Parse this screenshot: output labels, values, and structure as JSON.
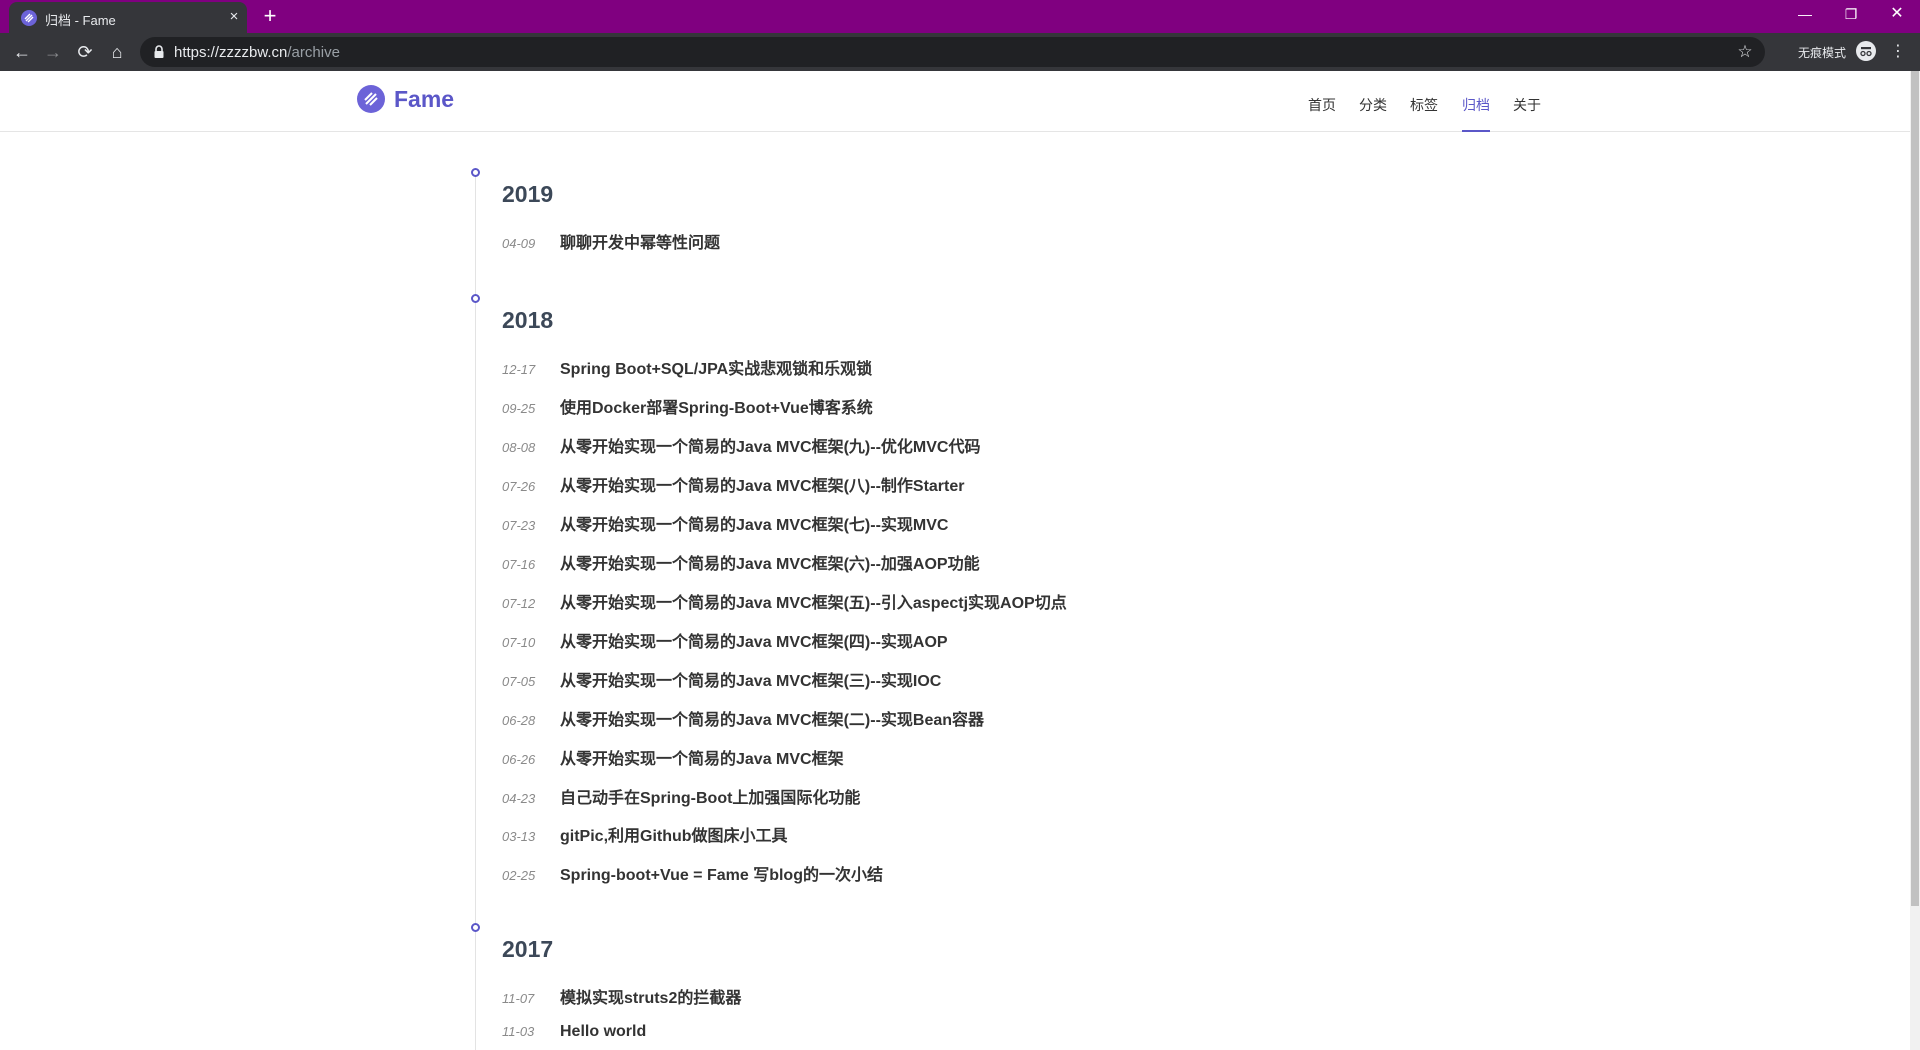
{
  "browser": {
    "tab": {
      "title": "归档 - Fame",
      "close_glyph": "×"
    },
    "new_tab_glyph": "+",
    "window_controls": {
      "minimize": "—",
      "maximize": "❐",
      "close": "✕"
    },
    "nav": {
      "back": "←",
      "forward": "→",
      "reload": "⟳",
      "home": "⌂"
    },
    "url": {
      "host": "https://zzzzbw.cn",
      "path": "/archive"
    },
    "bookmark_glyph": "☆",
    "incognito_label": "无痕模式",
    "menu_glyph": "⋮",
    "frame_color": "#800080"
  },
  "site": {
    "brand": "Fame",
    "accent_color": "#5b57c8",
    "nav": [
      {
        "label": "首页",
        "active": false
      },
      {
        "label": "分类",
        "active": false
      },
      {
        "label": "标签",
        "active": false
      },
      {
        "label": "归档",
        "active": true
      },
      {
        "label": "关于",
        "active": false
      }
    ]
  },
  "archive": [
    {
      "year": "2019",
      "posts": [
        {
          "date": "04-09",
          "title": "聊聊开发中幂等性问题"
        }
      ]
    },
    {
      "year": "2018",
      "posts": [
        {
          "date": "12-17",
          "title": "Spring Boot+SQL/JPA实战悲观锁和乐观锁"
        },
        {
          "date": "09-25",
          "title": "使用Docker部署Spring-Boot+Vue博客系统"
        },
        {
          "date": "08-08",
          "title": "从零开始实现一个简易的Java MVC框架(九)--优化MVC代码"
        },
        {
          "date": "07-26",
          "title": "从零开始实现一个简易的Java MVC框架(八)--制作Starter"
        },
        {
          "date": "07-23",
          "title": "从零开始实现一个简易的Java MVC框架(七)--实现MVC"
        },
        {
          "date": "07-16",
          "title": "从零开始实现一个简易的Java MVC框架(六)--加强AOP功能"
        },
        {
          "date": "07-12",
          "title": "从零开始实现一个简易的Java MVC框架(五)--引入aspectj实现AOP切点"
        },
        {
          "date": "07-10",
          "title": "从零开始实现一个简易的Java MVC框架(四)--实现AOP"
        },
        {
          "date": "07-05",
          "title": "从零开始实现一个简易的Java MVC框架(三)--实现IOC"
        },
        {
          "date": "06-28",
          "title": "从零开始实现一个简易的Java MVC框架(二)--实现Bean容器"
        },
        {
          "date": "06-26",
          "title": "从零开始实现一个简易的Java MVC框架"
        },
        {
          "date": "04-23",
          "title": "自己动手在Spring-Boot上加强国际化功能"
        },
        {
          "date": "03-13",
          "title": "gitPic,利用Github做图床小工具"
        },
        {
          "date": "02-25",
          "title": "Spring-boot+Vue = Fame 写blog的一次小结"
        }
      ]
    },
    {
      "year": "2017",
      "posts": [
        {
          "date": "11-07",
          "title": "模拟实现struts2的拦截器"
        },
        {
          "date": "11-03",
          "title": "Hello world"
        }
      ]
    }
  ]
}
